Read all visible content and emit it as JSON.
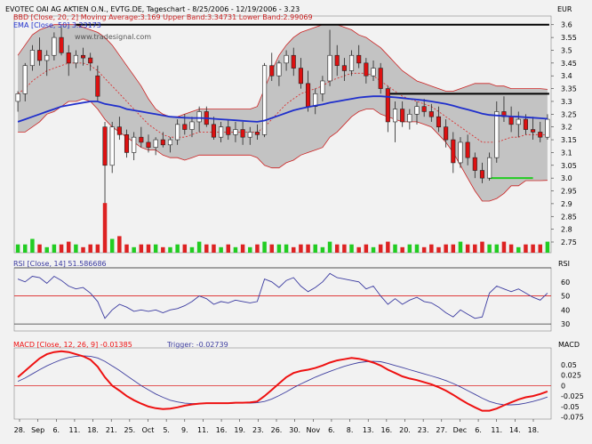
{
  "header": {
    "title": "EVOTEC OAI AG AKTIEN O.N., EVTG.DE, Tageschart - 8/25/2006 - 12/19/2006 - 3.23",
    "currency": "EUR",
    "bb_legend": "BBD [Close, 20, 2] Moving Average:3.169 Upper Band:3.34731 Lower Band:2.99069",
    "ema_legend": "EMA [Close, 50] 3.23173",
    "watermark": "www.tradesignal.com"
  },
  "colors": {
    "background": "#f2f2f2",
    "band_fill": "#c3c3c3",
    "band_edge": "#cc2222",
    "up_candle": "#ffffff",
    "down_candle": "#dd1111",
    "ema": "#1f2fcc",
    "ma": "#dd2222",
    "volume_up": "#22cc22",
    "volume_down": "#dd2222",
    "rsi": "#3a3aa0",
    "rsi_mid": "#dd2222",
    "macd": "#ee1111",
    "trigger": "#4040a0"
  },
  "chart_data": [
    {
      "type": "candlestick",
      "name": "price",
      "ylim": [
        2.95,
        3.6
      ],
      "y_ticks": [
        3.6,
        3.55,
        3.5,
        3.45,
        3.4,
        3.35,
        3.3,
        3.25,
        3.2,
        3.15,
        3.1,
        3.05,
        3.0,
        2.95,
        2.9,
        2.85,
        2.8,
        2.75
      ],
      "x_labels": [
        "28.",
        "Sep",
        "6.",
        "11.",
        "18.",
        "21.",
        "25.",
        "Oct",
        "5.",
        "9.",
        "11.",
        "16.",
        "19.",
        "23.",
        "26.",
        "30.",
        "Nov",
        "6.",
        "8.",
        "13.",
        "16.",
        "20.",
        "23.",
        "27.",
        "Dec",
        "6.",
        "11.",
        "14.",
        "18."
      ],
      "candles": [
        {
          "o": 3.3,
          "h": 3.34,
          "l": 3.26,
          "c": 3.33
        },
        {
          "o": 3.33,
          "h": 3.45,
          "l": 3.3,
          "c": 3.44
        },
        {
          "o": 3.44,
          "h": 3.52,
          "l": 3.42,
          "c": 3.5
        },
        {
          "o": 3.5,
          "h": 3.55,
          "l": 3.44,
          "c": 3.46
        },
        {
          "o": 3.46,
          "h": 3.5,
          "l": 3.4,
          "c": 3.48
        },
        {
          "o": 3.48,
          "h": 3.57,
          "l": 3.46,
          "c": 3.55
        },
        {
          "o": 3.55,
          "h": 3.59,
          "l": 3.48,
          "c": 3.49
        },
        {
          "o": 3.49,
          "h": 3.52,
          "l": 3.4,
          "c": 3.45
        },
        {
          "o": 3.45,
          "h": 3.5,
          "l": 3.43,
          "c": 3.48
        },
        {
          "o": 3.48,
          "h": 3.51,
          "l": 3.44,
          "c": 3.47
        },
        {
          "o": 3.47,
          "h": 3.49,
          "l": 3.42,
          "c": 3.45
        },
        {
          "o": 3.4,
          "h": 3.44,
          "l": 3.3,
          "c": 3.32
        },
        {
          "o": 3.2,
          "h": 3.22,
          "l": 2.9,
          "c": 3.05
        },
        {
          "o": 3.05,
          "h": 3.22,
          "l": 3.02,
          "c": 3.2
        },
        {
          "o": 3.2,
          "h": 3.24,
          "l": 3.15,
          "c": 3.17
        },
        {
          "o": 3.17,
          "h": 3.19,
          "l": 3.08,
          "c": 3.1
        },
        {
          "o": 3.1,
          "h": 3.18,
          "l": 3.07,
          "c": 3.16
        },
        {
          "o": 3.16,
          "h": 3.2,
          "l": 3.12,
          "c": 3.14
        },
        {
          "o": 3.14,
          "h": 3.17,
          "l": 3.1,
          "c": 3.12
        },
        {
          "o": 3.12,
          "h": 3.16,
          "l": 3.09,
          "c": 3.15
        },
        {
          "o": 3.15,
          "h": 3.18,
          "l": 3.12,
          "c": 3.13
        },
        {
          "o": 3.13,
          "h": 3.16,
          "l": 3.1,
          "c": 3.15
        },
        {
          "o": 3.15,
          "h": 3.23,
          "l": 3.13,
          "c": 3.21
        },
        {
          "o": 3.21,
          "h": 3.25,
          "l": 3.17,
          "c": 3.19
        },
        {
          "o": 3.19,
          "h": 3.24,
          "l": 3.16,
          "c": 3.22
        },
        {
          "o": 3.22,
          "h": 3.28,
          "l": 3.18,
          "c": 3.26
        },
        {
          "o": 3.26,
          "h": 3.28,
          "l": 3.2,
          "c": 3.21
        },
        {
          "o": 3.21,
          "h": 3.24,
          "l": 3.15,
          "c": 3.16
        },
        {
          "o": 3.16,
          "h": 3.22,
          "l": 3.14,
          "c": 3.2
        },
        {
          "o": 3.2,
          "h": 3.23,
          "l": 3.15,
          "c": 3.17
        },
        {
          "o": 3.17,
          "h": 3.22,
          "l": 3.14,
          "c": 3.19
        },
        {
          "o": 3.19,
          "h": 3.22,
          "l": 3.13,
          "c": 3.16
        },
        {
          "o": 3.16,
          "h": 3.2,
          "l": 3.13,
          "c": 3.18
        },
        {
          "o": 3.18,
          "h": 3.21,
          "l": 3.15,
          "c": 3.17
        },
        {
          "o": 3.17,
          "h": 3.45,
          "l": 3.16,
          "c": 3.44
        },
        {
          "o": 3.44,
          "h": 3.49,
          "l": 3.38,
          "c": 3.4
        },
        {
          "o": 3.4,
          "h": 3.46,
          "l": 3.36,
          "c": 3.45
        },
        {
          "o": 3.45,
          "h": 3.5,
          "l": 3.42,
          "c": 3.48
        },
        {
          "o": 3.48,
          "h": 3.51,
          "l": 3.4,
          "c": 3.43
        },
        {
          "o": 3.43,
          "h": 3.47,
          "l": 3.35,
          "c": 3.37
        },
        {
          "o": 3.37,
          "h": 3.42,
          "l": 3.26,
          "c": 3.28
        },
        {
          "o": 3.28,
          "h": 3.35,
          "l": 3.25,
          "c": 3.33
        },
        {
          "o": 3.33,
          "h": 3.4,
          "l": 3.3,
          "c": 3.38
        },
        {
          "o": 3.38,
          "h": 3.58,
          "l": 3.36,
          "c": 3.48
        },
        {
          "o": 3.48,
          "h": 3.52,
          "l": 3.4,
          "c": 3.44
        },
        {
          "o": 3.44,
          "h": 3.47,
          "l": 3.38,
          "c": 3.42
        },
        {
          "o": 3.42,
          "h": 3.5,
          "l": 3.4,
          "c": 3.48
        },
        {
          "o": 3.48,
          "h": 3.52,
          "l": 3.43,
          "c": 3.45
        },
        {
          "o": 3.45,
          "h": 3.47,
          "l": 3.37,
          "c": 3.4
        },
        {
          "o": 3.4,
          "h": 3.46,
          "l": 3.38,
          "c": 3.43
        },
        {
          "o": 3.43,
          "h": 3.45,
          "l": 3.33,
          "c": 3.35
        },
        {
          "o": 3.35,
          "h": 3.36,
          "l": 3.18,
          "c": 3.22
        },
        {
          "o": 3.22,
          "h": 3.3,
          "l": 3.14,
          "c": 3.27
        },
        {
          "o": 3.27,
          "h": 3.3,
          "l": 3.2,
          "c": 3.22
        },
        {
          "o": 3.22,
          "h": 3.27,
          "l": 3.19,
          "c": 3.25
        },
        {
          "o": 3.25,
          "h": 3.3,
          "l": 3.21,
          "c": 3.28
        },
        {
          "o": 3.28,
          "h": 3.31,
          "l": 3.24,
          "c": 3.26
        },
        {
          "o": 3.26,
          "h": 3.29,
          "l": 3.22,
          "c": 3.24
        },
        {
          "o": 3.24,
          "h": 3.28,
          "l": 3.18,
          "c": 3.2
        },
        {
          "o": 3.2,
          "h": 3.23,
          "l": 3.12,
          "c": 3.15
        },
        {
          "o": 3.15,
          "h": 3.18,
          "l": 3.02,
          "c": 3.06
        },
        {
          "o": 3.06,
          "h": 3.16,
          "l": 3.04,
          "c": 3.14
        },
        {
          "o": 3.14,
          "h": 3.17,
          "l": 3.05,
          "c": 3.08
        },
        {
          "o": 3.08,
          "h": 3.1,
          "l": 3.0,
          "c": 3.03
        },
        {
          "o": 3.03,
          "h": 3.06,
          "l": 2.98,
          "c": 3.0
        },
        {
          "o": 3.0,
          "h": 3.1,
          "l": 2.99,
          "c": 3.08
        },
        {
          "o": 3.08,
          "h": 3.3,
          "l": 3.06,
          "c": 3.26
        },
        {
          "o": 3.26,
          "h": 3.32,
          "l": 3.22,
          "c": 3.24
        },
        {
          "o": 3.24,
          "h": 3.28,
          "l": 3.18,
          "c": 3.21
        },
        {
          "o": 3.21,
          "h": 3.26,
          "l": 3.16,
          "c": 3.23
        },
        {
          "o": 3.23,
          "h": 3.25,
          "l": 3.17,
          "c": 3.19
        },
        {
          "o": 3.19,
          "h": 3.24,
          "l": 3.15,
          "c": 3.18
        },
        {
          "o": 3.18,
          "h": 3.22,
          "l": 3.14,
          "c": 3.16
        },
        {
          "o": 3.16,
          "h": 3.25,
          "l": 3.15,
          "c": 3.23
        }
      ],
      "ema": [
        3.22,
        3.23,
        3.24,
        3.25,
        3.26,
        3.27,
        3.28,
        3.285,
        3.29,
        3.295,
        3.3,
        3.3,
        3.29,
        3.285,
        3.28,
        3.27,
        3.265,
        3.26,
        3.255,
        3.25,
        3.245,
        3.24,
        3.238,
        3.236,
        3.235,
        3.235,
        3.234,
        3.232,
        3.23,
        3.228,
        3.226,
        3.224,
        3.222,
        3.22,
        3.225,
        3.235,
        3.245,
        3.255,
        3.265,
        3.272,
        3.278,
        3.283,
        3.288,
        3.295,
        3.3,
        3.305,
        3.31,
        3.315,
        3.318,
        3.32,
        3.32,
        3.318,
        3.316,
        3.313,
        3.31,
        3.307,
        3.304,
        3.3,
        3.295,
        3.29,
        3.283,
        3.275,
        3.268,
        3.26,
        3.252,
        3.247,
        3.245,
        3.243,
        3.241,
        3.24,
        3.238,
        3.236,
        3.234,
        3.232
      ],
      "bb_mid": [
        3.33,
        3.35,
        3.38,
        3.4,
        3.42,
        3.43,
        3.44,
        3.45,
        3.45,
        3.45,
        3.44,
        3.42,
        3.39,
        3.36,
        3.33,
        3.3,
        3.27,
        3.24,
        3.21,
        3.19,
        3.17,
        3.16,
        3.16,
        3.16,
        3.17,
        3.18,
        3.18,
        3.18,
        3.18,
        3.18,
        3.18,
        3.18,
        3.18,
        3.18,
        3.2,
        3.23,
        3.26,
        3.29,
        3.31,
        3.33,
        3.34,
        3.35,
        3.36,
        3.38,
        3.39,
        3.4,
        3.41,
        3.41,
        3.41,
        3.4,
        3.38,
        3.36,
        3.34,
        3.32,
        3.31,
        3.3,
        3.29,
        3.28,
        3.26,
        3.24,
        3.22,
        3.2,
        3.18,
        3.16,
        3.14,
        3.14,
        3.14,
        3.15,
        3.16,
        3.16,
        3.17,
        3.17,
        3.17,
        3.169
      ],
      "bb_upper": [
        3.48,
        3.52,
        3.56,
        3.58,
        3.59,
        3.6,
        3.6,
        3.6,
        3.6,
        3.59,
        3.58,
        3.57,
        3.55,
        3.52,
        3.48,
        3.44,
        3.4,
        3.36,
        3.31,
        3.27,
        3.25,
        3.24,
        3.24,
        3.25,
        3.26,
        3.27,
        3.27,
        3.27,
        3.27,
        3.27,
        3.27,
        3.27,
        3.27,
        3.28,
        3.35,
        3.42,
        3.48,
        3.52,
        3.55,
        3.57,
        3.58,
        3.59,
        3.6,
        3.6,
        3.6,
        3.59,
        3.58,
        3.56,
        3.55,
        3.53,
        3.51,
        3.48,
        3.45,
        3.42,
        3.4,
        3.38,
        3.37,
        3.36,
        3.35,
        3.34,
        3.34,
        3.35,
        3.36,
        3.37,
        3.37,
        3.37,
        3.36,
        3.36,
        3.35,
        3.35,
        3.35,
        3.35,
        3.35,
        3.347
      ],
      "bb_lower": [
        3.18,
        3.18,
        3.2,
        3.22,
        3.25,
        3.26,
        3.28,
        3.3,
        3.3,
        3.31,
        3.3,
        3.27,
        3.23,
        3.2,
        3.18,
        3.16,
        3.14,
        3.12,
        3.11,
        3.11,
        3.09,
        3.08,
        3.08,
        3.07,
        3.08,
        3.09,
        3.09,
        3.09,
        3.09,
        3.09,
        3.09,
        3.09,
        3.09,
        3.08,
        3.05,
        3.04,
        3.04,
        3.06,
        3.07,
        3.09,
        3.1,
        3.11,
        3.12,
        3.16,
        3.18,
        3.21,
        3.24,
        3.26,
        3.27,
        3.27,
        3.25,
        3.24,
        3.23,
        3.22,
        3.22,
        3.22,
        3.21,
        3.2,
        3.17,
        3.14,
        3.1,
        3.05,
        3.0,
        2.95,
        2.91,
        2.91,
        2.92,
        2.94,
        2.97,
        2.97,
        2.99,
        2.99,
        2.99,
        2.991
      ],
      "annotation_levels": [
        {
          "value": 3.6,
          "color": "#000000"
        },
        {
          "value": 3.33,
          "color": "#000000"
        },
        {
          "value": 3.0,
          "color": "#22cc22"
        }
      ]
    },
    {
      "type": "bar",
      "name": "volume",
      "values": [
        3,
        3,
        5,
        3,
        2,
        3,
        3,
        4,
        3,
        2,
        3,
        3,
        18,
        5,
        6,
        3,
        2,
        3,
        3,
        3,
        2,
        2,
        3,
        3,
        2,
        4,
        3,
        3,
        2,
        3,
        2,
        3,
        2,
        3,
        4,
        3,
        3,
        3,
        2,
        3,
        3,
        3,
        2,
        4,
        3,
        3,
        3,
        2,
        3,
        2,
        3,
        4,
        3,
        2,
        3,
        3,
        2,
        3,
        2,
        3,
        3,
        4,
        3,
        3,
        4,
        3,
        3,
        4,
        3,
        2,
        3,
        3,
        3,
        4
      ]
    },
    {
      "type": "line",
      "name": "RSI",
      "legend": "RSI [Close, 14] 51.586686",
      "ylim": [
        25,
        70
      ],
      "y_ticks": [
        60,
        50,
        40,
        30
      ],
      "reference_lines": [
        70,
        50,
        30
      ],
      "values": [
        62,
        60,
        64,
        63,
        59,
        64,
        61,
        57,
        55,
        56,
        52,
        46,
        34,
        40,
        44,
        42,
        39,
        40,
        39,
        40,
        38,
        40,
        41,
        43,
        46,
        50,
        48,
        44,
        46,
        45,
        47,
        46,
        45,
        46,
        62,
        60,
        56,
        61,
        63,
        57,
        53,
        56,
        60,
        66,
        63,
        62,
        61,
        60,
        55,
        57,
        50,
        44,
        48,
        44,
        47,
        49,
        46,
        45,
        42,
        38,
        35,
        40,
        37,
        34,
        35,
        52,
        57,
        55,
        53,
        55,
        52,
        49,
        47,
        52
      ]
    },
    {
      "type": "line",
      "name": "MACD",
      "legend": "MACD [Close, 12, 26, 9] -0.01385",
      "trigger_legend": "Trigger: -0.02739",
      "ylim": [
        -0.08,
        0.09
      ],
      "y_ticks": [
        0.05,
        0.025,
        0,
        -0.025,
        -0.05,
        -0.075
      ],
      "macd": [
        0.02,
        0.035,
        0.05,
        0.065,
        0.075,
        0.08,
        0.082,
        0.08,
        0.075,
        0.07,
        0.062,
        0.045,
        0.02,
        0.0,
        -0.012,
        -0.025,
        -0.035,
        -0.043,
        -0.05,
        -0.054,
        -0.056,
        -0.055,
        -0.052,
        -0.048,
        -0.045,
        -0.043,
        -0.042,
        -0.042,
        -0.042,
        -0.042,
        -0.041,
        -0.041,
        -0.04,
        -0.038,
        -0.025,
        -0.01,
        0.005,
        0.02,
        0.03,
        0.035,
        0.038,
        0.042,
        0.048,
        0.055,
        0.06,
        0.063,
        0.066,
        0.064,
        0.06,
        0.055,
        0.048,
        0.038,
        0.03,
        0.022,
        0.017,
        0.013,
        0.008,
        0.003,
        -0.004,
        -0.012,
        -0.022,
        -0.033,
        -0.043,
        -0.052,
        -0.06,
        -0.06,
        -0.055,
        -0.047,
        -0.04,
        -0.033,
        -0.028,
        -0.025,
        -0.02,
        -0.01385
      ],
      "trigger": [
        0.01,
        0.018,
        0.028,
        0.038,
        0.047,
        0.055,
        0.062,
        0.067,
        0.07,
        0.071,
        0.07,
        0.066,
        0.058,
        0.047,
        0.036,
        0.024,
        0.012,
        0.0,
        -0.01,
        -0.02,
        -0.028,
        -0.035,
        -0.039,
        -0.042,
        -0.043,
        -0.043,
        -0.043,
        -0.043,
        -0.043,
        -0.043,
        -0.042,
        -0.042,
        -0.042,
        -0.041,
        -0.038,
        -0.032,
        -0.024,
        -0.015,
        -0.005,
        0.004,
        0.012,
        0.02,
        0.027,
        0.034,
        0.04,
        0.046,
        0.051,
        0.055,
        0.057,
        0.058,
        0.057,
        0.053,
        0.048,
        0.043,
        0.038,
        0.033,
        0.028,
        0.023,
        0.018,
        0.012,
        0.005,
        -0.003,
        -0.012,
        -0.021,
        -0.03,
        -0.038,
        -0.043,
        -0.046,
        -0.046,
        -0.045,
        -0.042,
        -0.038,
        -0.033,
        -0.02739
      ]
    }
  ]
}
